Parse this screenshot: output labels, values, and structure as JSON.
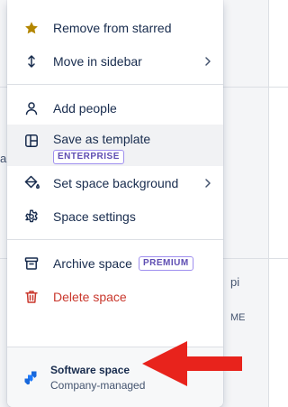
{
  "menu": {
    "starred": {
      "label": "Remove from starred",
      "icon": "star-icon"
    },
    "move": {
      "label": "Move in sidebar",
      "icon": "vertical-arrows-icon"
    },
    "add_people": {
      "label": "Add people",
      "icon": "person-icon"
    },
    "template": {
      "label": "Save as template",
      "badge": "ENTERPRISE",
      "icon": "template-icon"
    },
    "background": {
      "label": "Set space background",
      "icon": "paint-bucket-icon"
    },
    "settings": {
      "label": "Space settings",
      "icon": "gear-icon"
    },
    "archive": {
      "label": "Archive space",
      "badge": "PREMIUM",
      "icon": "archive-icon"
    },
    "delete": {
      "label": "Delete space",
      "icon": "trash-icon"
    }
  },
  "footer": {
    "title": "Software space",
    "subtitle": "Company-managed",
    "icon": "software-space-icon"
  },
  "backdrop": {
    "left_text": "al",
    "right_text_1": "pi",
    "right_text_2": "ME"
  },
  "colors": {
    "star": "#b38600",
    "danger": "#c9372c",
    "badge": "#5e4db2",
    "arrow": "#e8231c",
    "brand": "#1868db"
  }
}
